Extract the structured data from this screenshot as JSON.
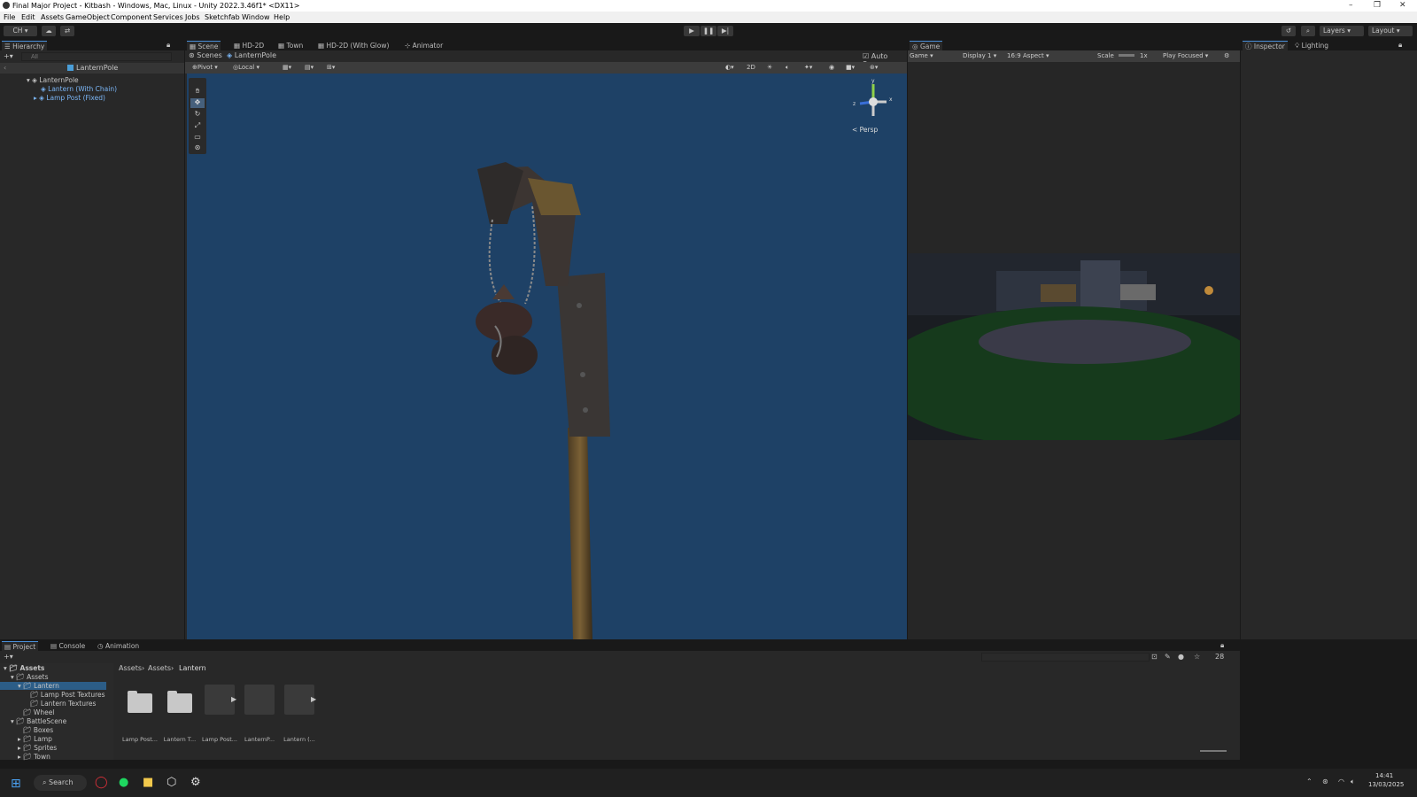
{
  "window": {
    "title": "Final Major Project - Kitbash - Windows, Mac, Linux - Unity 2022.3.46f1* <DX11>",
    "min": "–",
    "max": "❐",
    "close": "✕"
  },
  "menu": [
    "File",
    "Edit",
    "Assets",
    "GameObject",
    "Component",
    "Services",
    "Jobs",
    "Sketchfab",
    "Window",
    "Help"
  ],
  "toolbar": {
    "account": "CH",
    "layers": "Layers",
    "layout": "Layout"
  },
  "hierarchy": {
    "tab": "Hierarchy",
    "search_placeholder": "All",
    "root": "LanternPole",
    "items": [
      {
        "label": "LanternPole"
      },
      {
        "label": "Lantern (With Chain)"
      },
      {
        "label": "Lamp Post (Fixed)"
      }
    ]
  },
  "scene": {
    "tabs": [
      "Scene",
      "HD-2D",
      "Town",
      "HD-2D (With Glow)",
      "Animator"
    ],
    "breadcrumb": [
      "Scenes",
      "LanternPole"
    ],
    "auto_save": "Auto Save",
    "pivot": "Pivot",
    "local": "Local",
    "mode_2d": "2D",
    "persp": "< Persp",
    "gizmo_x": "x",
    "gizmo_y": "y",
    "gizmo_z": "z"
  },
  "game": {
    "tab": "Game",
    "view": "Game",
    "display": "Display 1",
    "aspect": "16:9 Aspect",
    "scale_label": "Scale",
    "scale_value": "1x",
    "play_focused": "Play Focused"
  },
  "inspector": {
    "tabs": [
      "Inspector",
      "Lighting"
    ]
  },
  "project": {
    "tabs": [
      "Project",
      "Console",
      "Animation"
    ],
    "count": "28",
    "breadcrumb": [
      "Assets",
      "Assets",
      "Lantern"
    ],
    "tree": [
      "Assets",
      "Assets",
      "Lantern",
      "Lamp Post Textures",
      "Lantern Textures",
      "Wheel",
      "BattleScene",
      "Boxes",
      "Lamp",
      "Sprites",
      "Town"
    ],
    "assets": [
      "Lamp Post...",
      "Lantern T...",
      "Lamp Post...",
      "LanternP...",
      "Lantern (..."
    ]
  },
  "taskbar": {
    "search": "Search",
    "time": "14:41",
    "date": "13/03/2025"
  },
  "colors": {
    "scene_bg": "#1e4166",
    "panel": "#282828",
    "accent": "#4a8ed8"
  }
}
